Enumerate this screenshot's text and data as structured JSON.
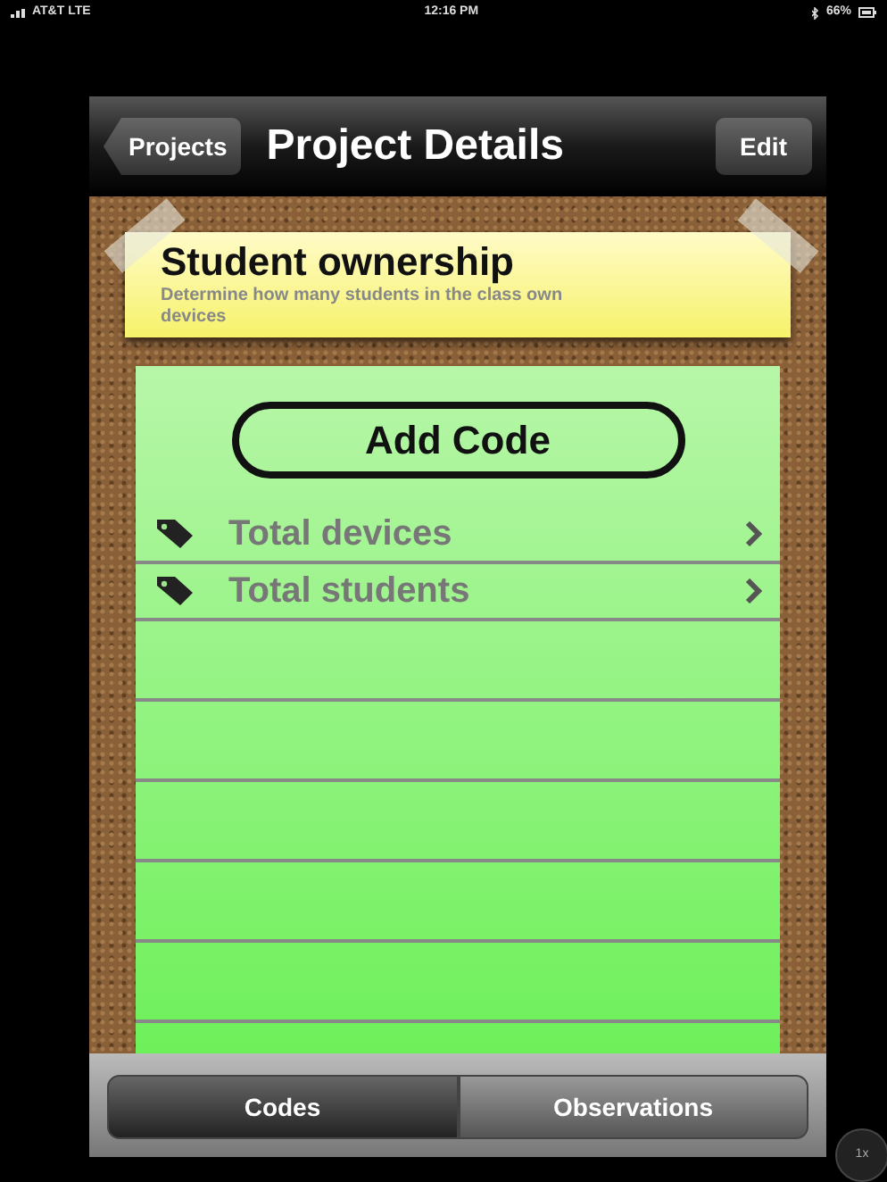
{
  "status_bar": {
    "carrier": "AT&T  LTE",
    "time": "12:16 PM",
    "battery": "66%"
  },
  "nav_bar": {
    "back": "Projects",
    "title": "Project Details",
    "action": "Edit"
  },
  "note": {
    "title": "Student ownership",
    "description": "Determine how many students in the class own devices"
  },
  "add_button": "Add Code",
  "codes": [
    {
      "label": "Total devices"
    },
    {
      "label": "Total students"
    }
  ],
  "tabs": [
    {
      "label": "Codes",
      "selected": true
    },
    {
      "label": "Observations",
      "selected": false
    }
  ],
  "zoom_button": "1x"
}
